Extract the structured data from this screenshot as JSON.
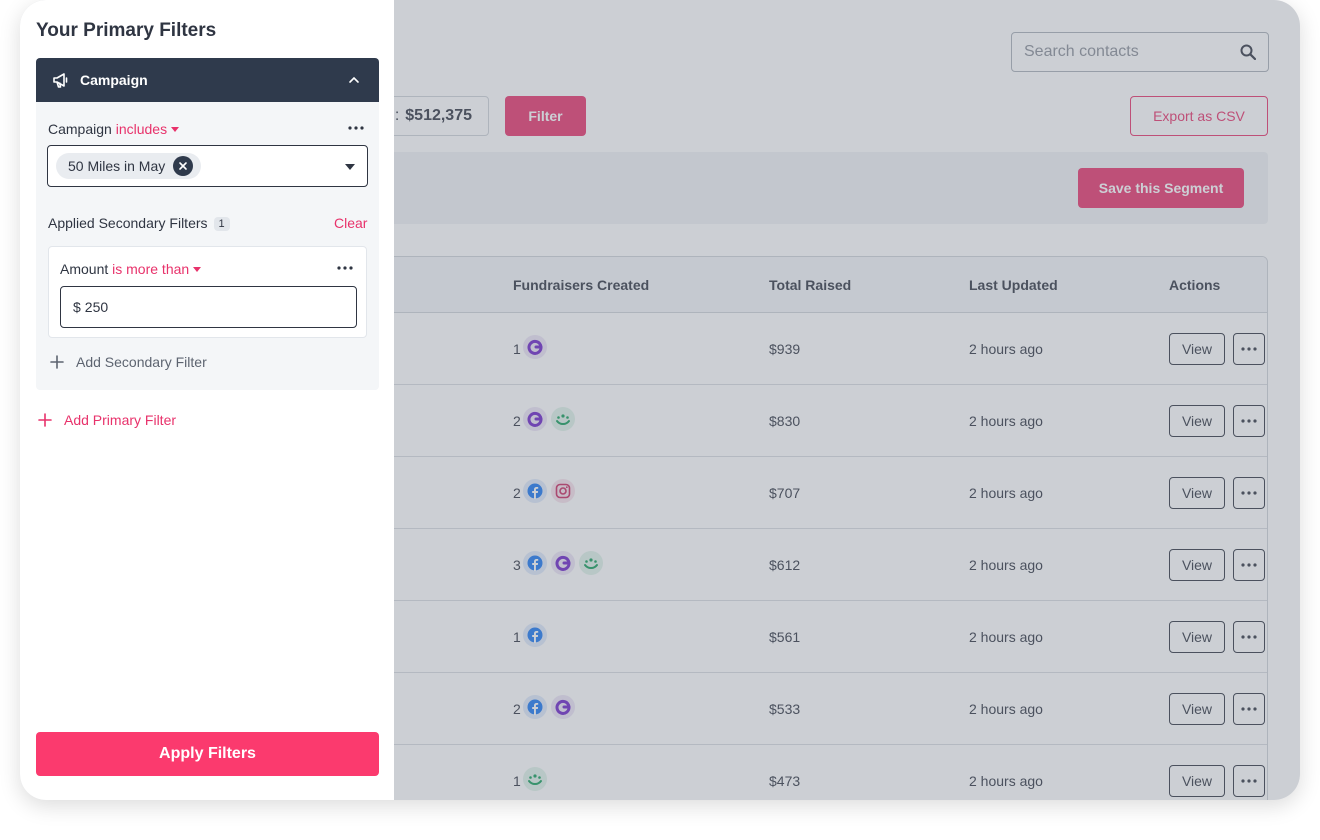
{
  "search": {
    "placeholder": "Search contacts"
  },
  "summary": {
    "total_label_partial": "l:",
    "total_value": "$512,375"
  },
  "toolbar": {
    "filter_label": "Filter",
    "export_label": "Export as CSV",
    "save_segment_label": "Save this Segment"
  },
  "table": {
    "columns": [
      "Fundraisers Created",
      "Total Raised",
      "Last Updated",
      "Actions"
    ],
    "rows": [
      {
        "fundraisers": "1",
        "platforms": [
          "gofundme"
        ],
        "total": "$939",
        "updated": "2 hours ago"
      },
      {
        "fundraisers": "2",
        "platforms": [
          "gofundme",
          "charity"
        ],
        "total": "$830",
        "updated": "2 hours ago"
      },
      {
        "fundraisers": "2",
        "platforms": [
          "facebook",
          "instagram"
        ],
        "total": "$707",
        "updated": "2 hours ago"
      },
      {
        "fundraisers": "3",
        "platforms": [
          "facebook",
          "gofundme",
          "charity"
        ],
        "total": "$612",
        "updated": "2 hours ago"
      },
      {
        "fundraisers": "1",
        "platforms": [
          "facebook"
        ],
        "total": "$561",
        "updated": "2 hours ago"
      },
      {
        "fundraisers": "2",
        "platforms": [
          "facebook",
          "gofundme"
        ],
        "total": "$533",
        "updated": "2 hours ago"
      },
      {
        "fundraisers": "1",
        "platforms": [
          "charity"
        ],
        "total": "$473",
        "updated": "2 hours ago"
      }
    ],
    "view_label": "View"
  },
  "panel": {
    "title": "Your Primary Filters",
    "accordion_label": "Campaign",
    "campaign_label": "Campaign",
    "campaign_operator": "includes",
    "selected_campaign": "50 Miles in May",
    "secondary_title": "Applied Secondary Filters",
    "secondary_count": "1",
    "clear_label": "Clear",
    "amount_label": "Amount",
    "amount_operator": "is more than",
    "amount_currency": "$",
    "amount_value": "250",
    "add_secondary_label": "Add Secondary Filter",
    "add_primary_label": "Add Primary Filter",
    "apply_label": "Apply Filters"
  },
  "colors": {
    "accent": "#e8326b",
    "apply": "#fb3a6e",
    "dark": "#2f3a4c"
  },
  "icons": {
    "platforms": [
      "gofundme-icon",
      "charity-icon",
      "facebook-icon",
      "instagram-icon"
    ]
  }
}
